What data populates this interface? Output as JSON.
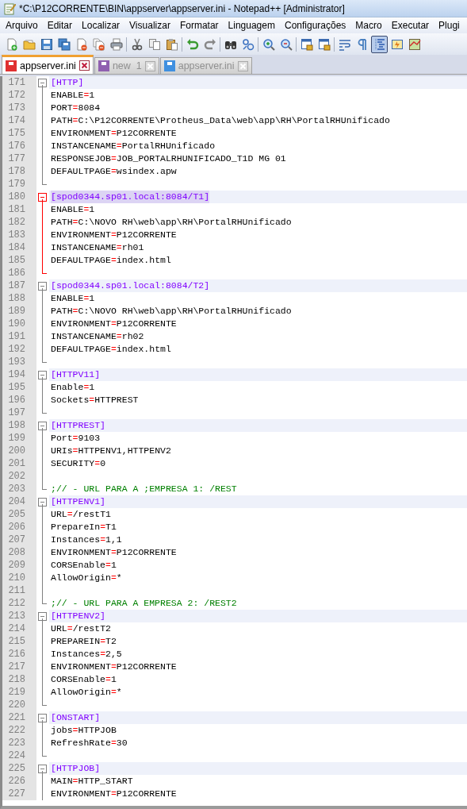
{
  "window": {
    "title": "*C:\\P12CORRENTE\\BIN\\appserver\\appserver.ini - Notepad++ [Administrator]"
  },
  "menu": [
    "Arquivo",
    "Editar",
    "Localizar",
    "Visualizar",
    "Formatar",
    "Linguagem",
    "Configurações",
    "Macro",
    "Executar",
    "Plugi"
  ],
  "toolbar": [
    [
      {
        "kind": "new",
        "pressed": false
      },
      {
        "kind": "open",
        "pressed": false
      },
      {
        "kind": "save",
        "pressed": false
      },
      {
        "kind": "save-all",
        "pressed": false
      },
      {
        "kind": "close",
        "pressed": false
      },
      {
        "kind": "close-all",
        "pressed": false
      },
      {
        "kind": "print",
        "pressed": false
      }
    ],
    [
      {
        "kind": "cut",
        "pressed": false
      },
      {
        "kind": "copy",
        "pressed": false
      },
      {
        "kind": "paste",
        "pressed": false
      }
    ],
    [
      {
        "kind": "undo",
        "pressed": false
      },
      {
        "kind": "redo",
        "pressed": false
      }
    ],
    [
      {
        "kind": "find",
        "pressed": false
      },
      {
        "kind": "replace",
        "pressed": false
      }
    ],
    [
      {
        "kind": "zoom-in",
        "pressed": false
      },
      {
        "kind": "zoom-out",
        "pressed": false
      }
    ],
    [
      {
        "kind": "sync-v",
        "pressed": false
      },
      {
        "kind": "sync-h",
        "pressed": false
      }
    ],
    [
      {
        "kind": "wrap",
        "pressed": false
      },
      {
        "kind": "show-all",
        "pressed": false
      },
      {
        "kind": "indent-guide",
        "pressed": true
      },
      {
        "kind": "panel",
        "pressed": false
      },
      {
        "kind": "map",
        "pressed": false
      }
    ]
  ],
  "tabs": [
    {
      "label": "appserver.ini",
      "selected": true,
      "color": "#e03030"
    },
    {
      "label": "new  1",
      "selected": false,
      "color": "#9060b0"
    },
    {
      "label": "appserver.ini",
      "selected": false,
      "color": "#4090e0"
    }
  ],
  "sections": [
    {
      "number": "171",
      "header": "[HTTP]",
      "selected": false,
      "end_visible": true,
      "lines": [
        {
          "number": "172",
          "kind": "key",
          "key": "ENABLE",
          "sign": "=",
          "value": "1"
        },
        {
          "number": "173",
          "kind": "key",
          "key": "PORT",
          "sign": "=",
          "value": "8084"
        },
        {
          "number": "174",
          "kind": "key",
          "key": "PATH",
          "sign": "=",
          "value": "C:\\P12CORRENTE\\Protheus_Data\\web\\app\\RH\\PortalRHUnificado"
        },
        {
          "number": "175",
          "kind": "key",
          "key": "ENVIRONMENT",
          "sign": "=",
          "value": "P12CORRENTE"
        },
        {
          "number": "176",
          "kind": "key",
          "key": "INSTANCENAME",
          "sign": "=",
          "value": "PortalRHUnificado"
        },
        {
          "number": "177",
          "kind": "key",
          "key": "RESPONSEJOB",
          "sign": "=",
          "value": "JOB_PORTALRHUNIFICADO_T1D MG 01"
        },
        {
          "number": "178",
          "kind": "key",
          "key": "DEFAULTPAGE",
          "sign": "=",
          "value": "wsindex.apw"
        },
        {
          "number": "179",
          "kind": "blank"
        }
      ]
    },
    {
      "number": "180",
      "header": "[spod0344.sp01.local:8084/T1]",
      "selected": true,
      "end_visible": true,
      "lines": [
        {
          "number": "181",
          "kind": "key",
          "key": "ENABLE",
          "sign": "=",
          "value": "1"
        },
        {
          "number": "182",
          "kind": "key",
          "key": "PATH",
          "sign": "=",
          "value": "C:\\NOVO RH\\web\\app\\RH\\PortalRHUnificado"
        },
        {
          "number": "183",
          "kind": "key",
          "key": "ENVIRONMENT",
          "sign": "=",
          "value": "P12CORRENTE"
        },
        {
          "number": "184",
          "kind": "key",
          "key": "INSTANCENAME",
          "sign": "=",
          "value": "rh01"
        },
        {
          "number": "185",
          "kind": "key",
          "key": "DEFAULTPAGE",
          "sign": "=",
          "value": "index.html"
        },
        {
          "number": "186",
          "kind": "blank"
        }
      ]
    },
    {
      "number": "187",
      "header": "[spod0344.sp01.local:8084/T2]",
      "selected": false,
      "end_visible": true,
      "lines": [
        {
          "number": "188",
          "kind": "key",
          "key": "ENABLE",
          "sign": "=",
          "value": "1"
        },
        {
          "number": "189",
          "kind": "key",
          "key": "PATH",
          "sign": "=",
          "value": "C:\\NOVO RH\\web\\app\\RH\\PortalRHUnificado"
        },
        {
          "number": "190",
          "kind": "key",
          "key": "ENVIRONMENT",
          "sign": "=",
          "value": "P12CORRENTE"
        },
        {
          "number": "191",
          "kind": "key",
          "key": "INSTANCENAME",
          "sign": "=",
          "value": "rh02"
        },
        {
          "number": "192",
          "kind": "key",
          "key": "DEFAULTPAGE",
          "sign": "=",
          "value": "index.html"
        },
        {
          "number": "193",
          "kind": "blank"
        }
      ]
    },
    {
      "number": "194",
      "header": "[HTTPV11]",
      "selected": false,
      "end_visible": true,
      "lines": [
        {
          "number": "195",
          "kind": "key",
          "key": "Enable",
          "sign": "=",
          "value": "1"
        },
        {
          "number": "196",
          "kind": "key",
          "key": "Sockets",
          "sign": "=",
          "value": "HTTPREST"
        },
        {
          "number": "197",
          "kind": "blank"
        }
      ]
    },
    {
      "number": "198",
      "header": "[HTTPREST]",
      "selected": false,
      "end_visible": true,
      "lines": [
        {
          "number": "199",
          "kind": "key",
          "key": "Port",
          "sign": "=",
          "value": "9103"
        },
        {
          "number": "200",
          "kind": "key",
          "key": "URIs",
          "sign": "=",
          "value": "HTTPENV1,HTTPENV2"
        },
        {
          "number": "201",
          "kind": "key",
          "key": "SECURITY",
          "sign": "=",
          "value": "0"
        },
        {
          "number": "202",
          "kind": "blank"
        },
        {
          "number": "203",
          "kind": "comment",
          "text": ";// - URL PARA A ;EMPRESA 1: /REST"
        }
      ]
    },
    {
      "number": "204",
      "header": "[HTTPENV1]",
      "selected": false,
      "end_visible": true,
      "lines": [
        {
          "number": "205",
          "kind": "key",
          "key": "URL",
          "sign": "=",
          "value": "/restT1"
        },
        {
          "number": "206",
          "kind": "key",
          "key": "PrepareIn",
          "sign": "=",
          "value": "T1"
        },
        {
          "number": "207",
          "kind": "key",
          "key": "Instances",
          "sign": "=",
          "value": "1,1"
        },
        {
          "number": "208",
          "kind": "key",
          "key": "ENVIRONMENT",
          "sign": "=",
          "value": "P12CORRENTE"
        },
        {
          "number": "209",
          "kind": "key",
          "key": "CORSEnable",
          "sign": "=",
          "value": "1"
        },
        {
          "number": "210",
          "kind": "key",
          "key": "AllowOrigin",
          "sign": "=",
          "value": "*"
        },
        {
          "number": "211",
          "kind": "blank"
        },
        {
          "number": "212",
          "kind": "comment",
          "text": ";// - URL PARA A EMPRESA 2: /REST2"
        }
      ]
    },
    {
      "number": "213",
      "header": "[HTTPENV2]",
      "selected": false,
      "end_visible": true,
      "lines": [
        {
          "number": "214",
          "kind": "key",
          "key": "URL",
          "sign": "=",
          "value": "/restT2"
        },
        {
          "number": "215",
          "kind": "key",
          "key": "PREPAREIN",
          "sign": "=",
          "value": "T2"
        },
        {
          "number": "216",
          "kind": "key",
          "key": "Instances",
          "sign": "=",
          "value": "2,5"
        },
        {
          "number": "217",
          "kind": "key",
          "key": "ENVIRONMENT",
          "sign": "=",
          "value": "P12CORRENTE"
        },
        {
          "number": "218",
          "kind": "key",
          "key": "CORSEnable",
          "sign": "=",
          "value": "1"
        },
        {
          "number": "219",
          "kind": "key",
          "key": "AllowOrigin",
          "sign": "=",
          "value": "*"
        },
        {
          "number": "220",
          "kind": "blank"
        }
      ]
    },
    {
      "number": "221",
      "header": "[ONSTART]",
      "selected": false,
      "end_visible": true,
      "lines": [
        {
          "number": "222",
          "kind": "key",
          "key": "jobs",
          "sign": "=",
          "value": "HTTPJOB"
        },
        {
          "number": "223",
          "kind": "key",
          "key": "RefreshRate",
          "sign": "=",
          "value": "30"
        },
        {
          "number": "224",
          "kind": "blank"
        }
      ]
    },
    {
      "number": "225",
      "header": "[HTTPJOB]",
      "selected": false,
      "end_visible": false,
      "lines": [
        {
          "number": "226",
          "kind": "key",
          "key": "MAIN",
          "sign": "=",
          "value": "HTTP_START"
        },
        {
          "number": "227",
          "kind": "key",
          "key": "ENVIRONMENT",
          "sign": "=",
          "value": "P12CORRENTE"
        }
      ]
    }
  ]
}
